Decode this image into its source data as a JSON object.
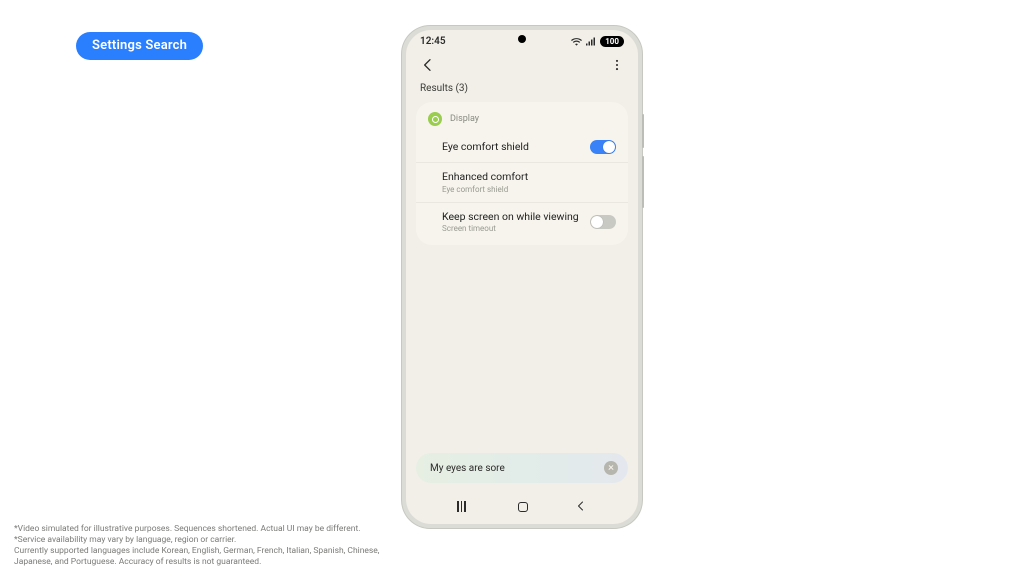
{
  "badge": "Settings Search",
  "status": {
    "time": "12:45",
    "battery": "100"
  },
  "header": {},
  "results_label": "Results (3)",
  "section": {
    "name": "Display"
  },
  "items": [
    {
      "title": "Eye comfort shield",
      "sub": "",
      "toggle": true,
      "toggle_on": true
    },
    {
      "title": "Enhanced comfort",
      "sub": "Eye comfort shield",
      "toggle": false
    },
    {
      "title": "Keep screen on while viewing",
      "sub": "Screen timeout",
      "toggle": true,
      "toggle_on": false
    }
  ],
  "search": {
    "query": "My eyes are sore"
  },
  "footnotes": [
    "*Video simulated for illustrative purposes. Sequences shortened. Actual UI may be different.",
    "*Service availability may vary by language, region or carrier.",
    " Currently supported languages include Korean, English, German, French, Italian, Spanish, Chinese, Japanese, and Portuguese. Accuracy of results is not guaranteed."
  ]
}
